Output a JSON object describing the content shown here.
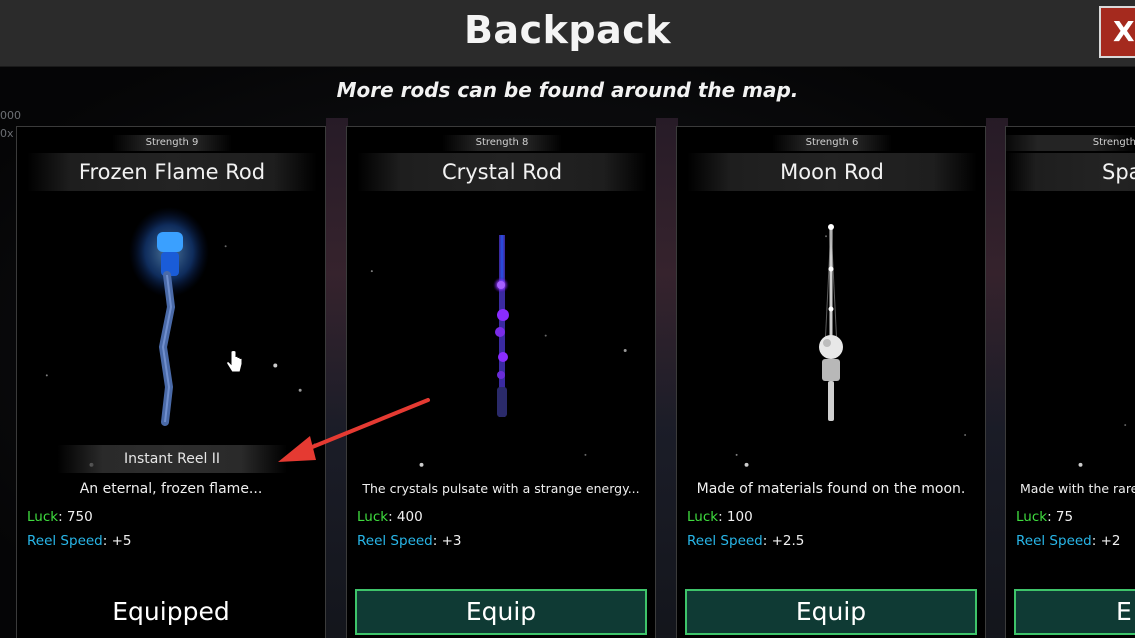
{
  "window": {
    "title": "Backpack",
    "close_label": "X",
    "subtitle": "More rods can be found around the map."
  },
  "background": {
    "left_fragment_top": "000",
    "left_fragment_bottom": "0x"
  },
  "cards": [
    {
      "strength": "Strength 9",
      "name": "Frozen Flame Rod",
      "enchant": "Instant Reel II",
      "description": "An eternal, frozen flame...",
      "luck_label": "Luck",
      "luck_value": ": 750",
      "speed_label": "Reel Speed",
      "speed_value": ": +5",
      "action": "Equipped",
      "equipped": true,
      "rod_color": "#2a7bff",
      "icon": "frozen-flame-rod-icon"
    },
    {
      "strength": "Strength 8",
      "name": "Crystal Rod",
      "description": "The crystals pulsate with a strange energy...",
      "luck_label": "Luck",
      "luck_value": ": 400",
      "speed_label": "Reel Speed",
      "speed_value": ": +3",
      "action": "Equip",
      "equipped": false,
      "rod_color": "#8a2cff",
      "icon": "crystal-rod-icon"
    },
    {
      "strength": "Strength 6",
      "name": "Moon Rod",
      "description": "Made of materials found on the moon.",
      "luck_label": "Luck",
      "luck_value": ": 100",
      "speed_label": "Reel Speed",
      "speed_value": ": +2.5",
      "action": "Equip",
      "equipped": false,
      "rod_color": "#d8d8d8",
      "icon": "moon-rod-icon"
    },
    {
      "strength": "Strength",
      "name": "Spa",
      "description": "Made with the rare",
      "luck_label": "Luck",
      "luck_value": ": 75",
      "speed_label": "Reel Speed",
      "speed_value": ": +2",
      "action": "E",
      "equipped": false,
      "icon": "partial-rod-icon"
    }
  ],
  "colors": {
    "luck": "#3fdc3f",
    "reel_speed": "#28b6e8",
    "equip_border": "#3ec46a",
    "close_bg": "#a52a1e",
    "annotation_arrow": "#e53a32"
  }
}
